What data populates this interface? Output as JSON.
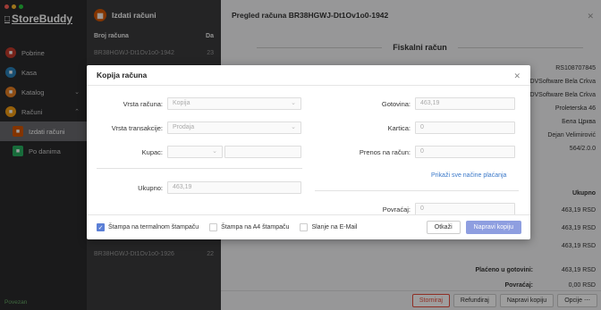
{
  "app": {
    "name": "StoreBuddy",
    "status": "Povezan"
  },
  "sidebar": {
    "items": [
      {
        "label": "Pobrine",
        "icon": "basket-icon"
      },
      {
        "label": "Kasa",
        "icon": "register-icon"
      },
      {
        "label": "Katalog",
        "icon": "catalog-icon"
      },
      {
        "label": "Računi",
        "icon": "receipt-icon"
      },
      {
        "label": "Izdati računi",
        "icon": "issued-icon"
      },
      {
        "label": "Po danima",
        "icon": "calendar-icon"
      }
    ]
  },
  "list": {
    "title": "Izdati računi",
    "columns": [
      "Broj računa",
      "Da"
    ],
    "rows": [
      {
        "number": "BR38HGWJ-Dt1Ov1o0-1942",
        "day": "23"
      },
      {
        "number": "BR38HGWJ-Dt1Ov1o0-1926",
        "day": "22"
      }
    ]
  },
  "detail": {
    "title": "Pregled računa BR38HGWJ-Dt1Ov1o0-1942",
    "section": "Fiskalni račun",
    "info": [
      "RS108707845",
      "e DVSoftware Bela Crkva",
      "e DVSoftware Bela Crkva",
      "Proleterska 46",
      "Бела Црква",
      "Dejan Velimirović",
      "564/2.0.0"
    ],
    "table_header": "Ukupno",
    "table_rows": [
      "463,19 RSD",
      "463,19 RSD",
      "463,19 RSD"
    ],
    "totals": [
      {
        "label": "Plaćeno u gotovini:",
        "value": "463,19 RSD"
      },
      {
        "label": "Povraćaj:",
        "value": "0,00 RSD"
      }
    ],
    "buttons": {
      "storniraj": "Storniraj",
      "refundiraj": "Refundiraj",
      "napravi_kopiju": "Napravi kopiju",
      "opcije": "Opcije"
    }
  },
  "modal": {
    "title": "Kopija računa",
    "vrsta_racuna": {
      "label": "Vrsta računa:",
      "value": "Kopija"
    },
    "vrsta_transakcije": {
      "label": "Vrsta transakcije:",
      "value": "Prodaja"
    },
    "kupac": {
      "label": "Kupac:",
      "value": ""
    },
    "ukupno": {
      "label": "Ukupno:",
      "value": "463,19"
    },
    "gotovina": {
      "label": "Gotovina:",
      "value": "463,19"
    },
    "kartica": {
      "label": "Kartica:",
      "value": "0"
    },
    "prenos": {
      "label": "Prenos na račun:",
      "value": "0"
    },
    "show_all_link": "Prikaži sve načine plaćanja",
    "povracaj": {
      "label": "Povraćaj:",
      "value": "0"
    },
    "options": [
      {
        "label": "Štampa na termalnom štampaču",
        "checked": true
      },
      {
        "label": "Štampa na A4 štampaču",
        "checked": false
      },
      {
        "label": "Slanje na E-Mail",
        "checked": false
      }
    ],
    "cancel": "Otkaži",
    "submit": "Napravi kopiju"
  }
}
